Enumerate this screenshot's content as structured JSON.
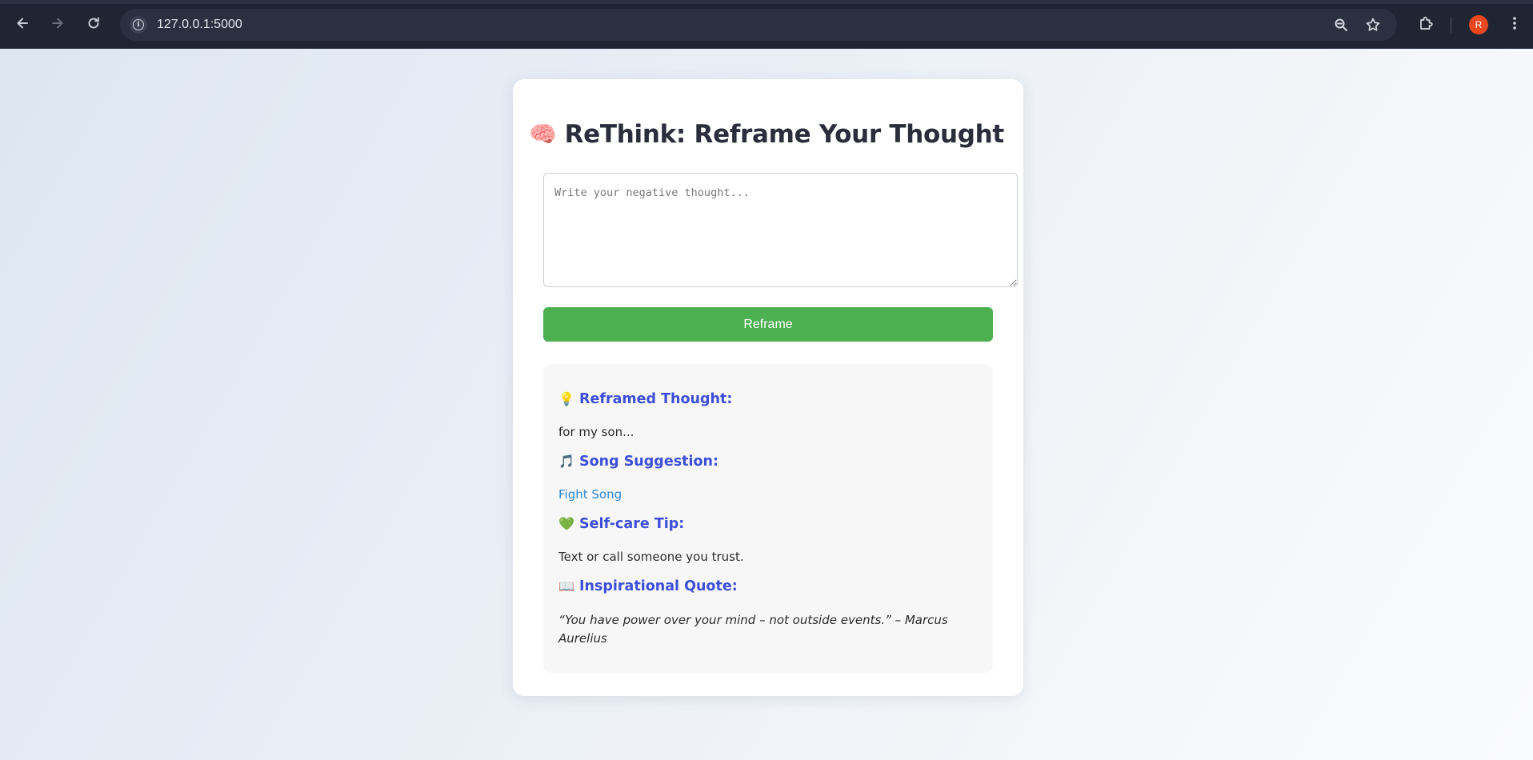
{
  "browser": {
    "url": "127.0.0.1:5000",
    "back_icon": "arrow-left",
    "forward_icon": "arrow-right",
    "reload_icon": "reload",
    "profile_initial": "R"
  },
  "app": {
    "title_emoji": "🧠",
    "title": "ReThink: Reframe Your Thought",
    "input_placeholder": "Write your negative thought...",
    "input_value": "",
    "button_label": "Reframe"
  },
  "result": {
    "reframed": {
      "emoji": "💡",
      "heading": "Reframed Thought:",
      "text": "for my son..."
    },
    "song": {
      "emoji": "🎵",
      "heading": "Song Suggestion:",
      "text": "Fight Song"
    },
    "selfcare": {
      "emoji": "💚",
      "heading": "Self-care Tip:",
      "text": "Text or call someone you trust."
    },
    "quote": {
      "emoji": "📖",
      "heading": "Inspirational Quote:",
      "text": "“You have power over your mind – not outside events.” – Marcus Aurelius"
    }
  },
  "colors": {
    "accent": "#4caf50",
    "heading": "#3d4fd8",
    "link": "#2b86d6"
  }
}
